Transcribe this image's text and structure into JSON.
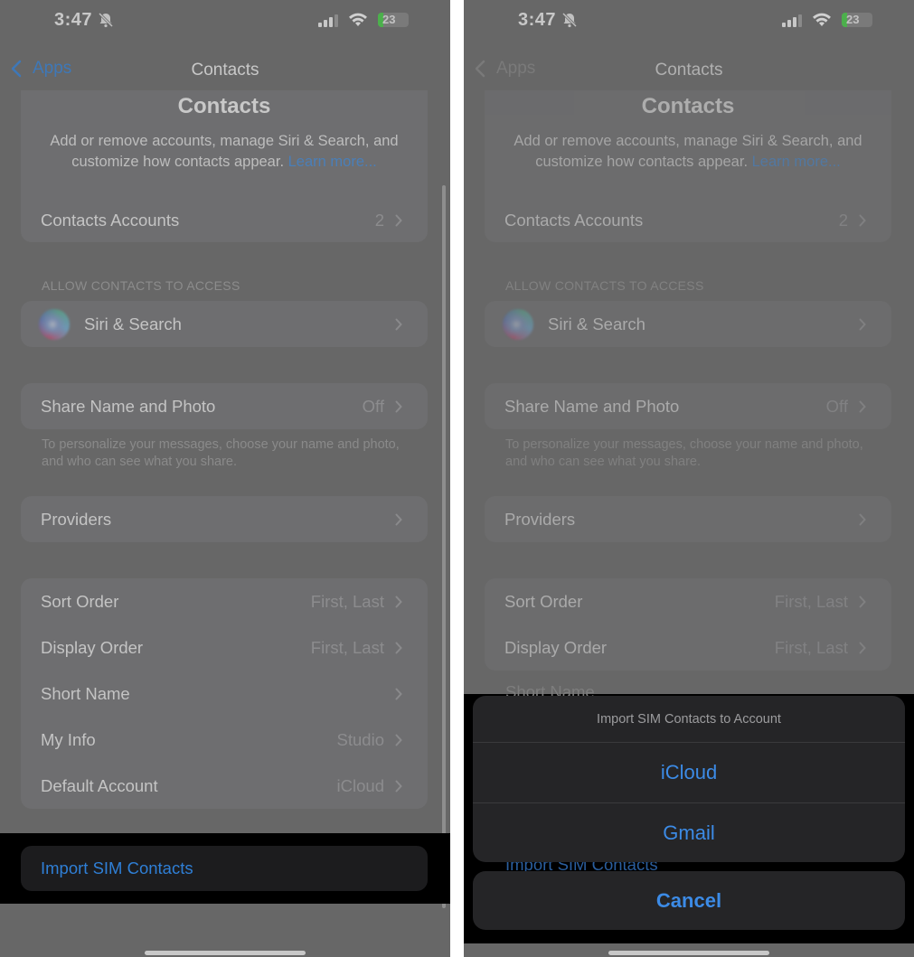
{
  "status_bar": {
    "time": "3:47",
    "battery": "23"
  },
  "nav": {
    "back_label": "Apps",
    "title": "Contacts"
  },
  "header": {
    "title": "Contacts",
    "description": "Add or remove accounts, manage Siri & Search, and customize how contacts appear.",
    "learn_more": "Learn more..."
  },
  "contacts_accounts": {
    "label": "Contacts Accounts",
    "value": "2"
  },
  "allow_section": {
    "header": "ALLOW CONTACTS TO ACCESS",
    "siri_label": "Siri & Search"
  },
  "share": {
    "label": "Share Name and Photo",
    "value": "Off",
    "footnote": "To personalize your messages, choose your name and photo, and who can see what you share."
  },
  "providers": {
    "label": "Providers"
  },
  "preferences": [
    {
      "label": "Sort Order",
      "value": "First, Last"
    },
    {
      "label": "Display Order",
      "value": "First, Last"
    },
    {
      "label": "Short Name",
      "value": ""
    },
    {
      "label": "My Info",
      "value": "Studio"
    },
    {
      "label": "Default Account",
      "value": "iCloud"
    }
  ],
  "import": {
    "label": "Import SIM Contacts"
  },
  "action_sheet": {
    "title": "Import SIM Contacts to Account",
    "options": [
      "iCloud",
      "Gmail"
    ],
    "cancel": "Cancel"
  },
  "colors": {
    "accent": "#3c8be6",
    "background": "#676767"
  }
}
